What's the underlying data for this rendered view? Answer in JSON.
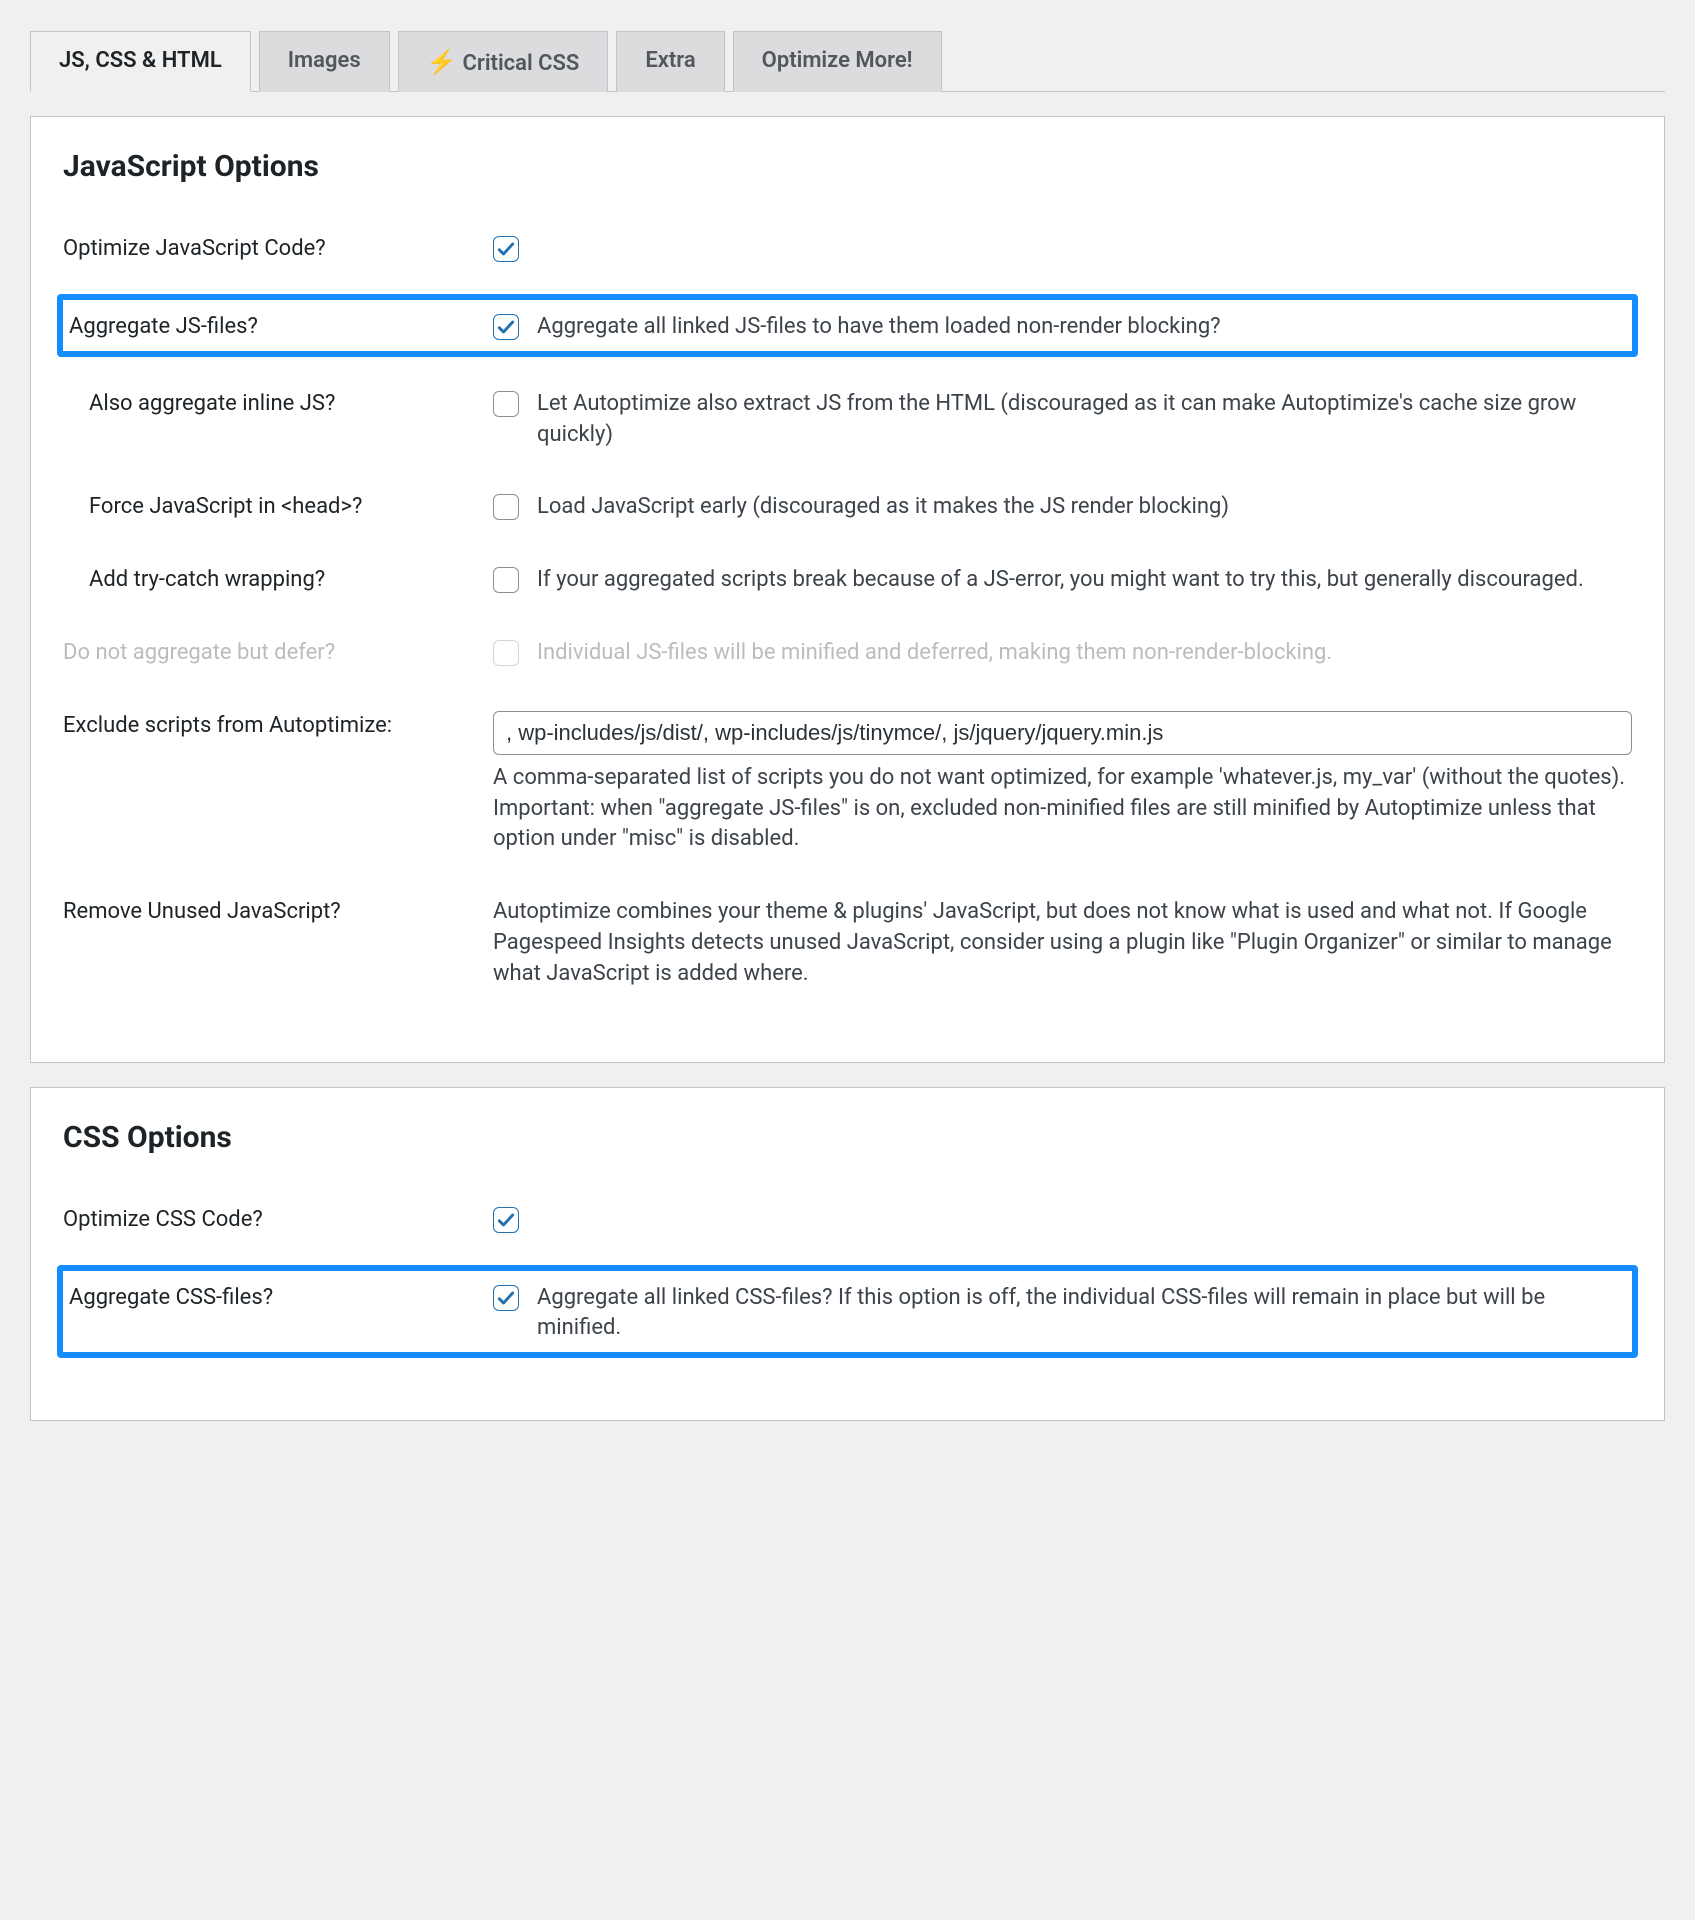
{
  "tabs": {
    "js_css_html": "JS, CSS & HTML",
    "images": "Images",
    "critical_css": "Critical CSS",
    "extra": "Extra",
    "optimize_more": "Optimize More!"
  },
  "js": {
    "heading": "JavaScript Options",
    "optimize_label": "Optimize JavaScript Code?",
    "aggregate_label": "Aggregate JS-files?",
    "aggregate_desc": "Aggregate all linked JS-files to have them loaded non-render blocking?",
    "inline_label": "Also aggregate inline JS?",
    "inline_desc": "Let Autoptimize also extract JS from the HTML (discouraged as it can make Autoptimize's cache size grow quickly)",
    "force_head_label": "Force JavaScript in <head>?",
    "force_head_desc": "Load JavaScript early (discouraged as it makes the JS render blocking)",
    "trycatch_label": "Add try-catch wrapping?",
    "trycatch_desc": "If your aggregated scripts break because of a JS-error, you might want to try this, but generally discouraged.",
    "defer_label": "Do not aggregate but defer?",
    "defer_desc": "Individual JS-files will be minified and deferred, making them non-render-blocking.",
    "exclude_label": "Exclude scripts from Autoptimize:",
    "exclude_value": ", wp-includes/js/dist/, wp-includes/js/tinymce/, js/jquery/jquery.min.js",
    "exclude_desc": "A comma-separated list of scripts you do not want optimized, for example 'whatever.js, my_var' (without the quotes). Important: when \"aggregate JS-files\" is on, excluded non-minified files are still minified by Autoptimize unless that option under \"misc\" is disabled.",
    "remove_label": "Remove Unused JavaScript?",
    "remove_desc": "Autoptimize combines your theme & plugins' JavaScript, but does not know what is used and what not. If Google Pagespeed Insights detects unused JavaScript, consider using a plugin like \"Plugin Organizer\" or similar to manage what JavaScript is added where."
  },
  "css": {
    "heading": "CSS Options",
    "optimize_label": "Optimize CSS Code?",
    "aggregate_label": "Aggregate CSS-files?",
    "aggregate_desc": "Aggregate all linked CSS-files? If this option is off, the individual CSS-files will remain in place but will be minified."
  }
}
